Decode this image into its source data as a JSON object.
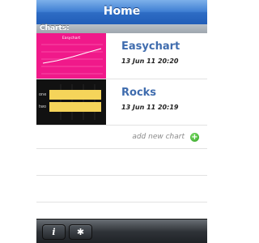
{
  "nav": {
    "title": "Home"
  },
  "section": {
    "header": "Charts:"
  },
  "charts": [
    {
      "name": "Easychart",
      "date": "13 Jun 11 20:20",
      "thumb_title": "Easychart"
    },
    {
      "name": "Rocks",
      "date": "13 Jun 11 20:19",
      "thumb_labels": [
        "one",
        "two"
      ]
    }
  ],
  "add_new": {
    "label": "add new chart",
    "icon": "plus-circle-icon",
    "icon_glyph": "+"
  },
  "toolbar": {
    "info": {
      "icon": "info-icon",
      "glyph": "i"
    },
    "settings": {
      "icon": "gear-icon",
      "glyph": "✱"
    }
  },
  "colors": {
    "navbar": "#3f7fd3",
    "chart_name": "#3f6cae",
    "thumb_pink": "#f0198a",
    "thumb_yellow": "#f5d45a",
    "add_green": "#2f9e22"
  }
}
